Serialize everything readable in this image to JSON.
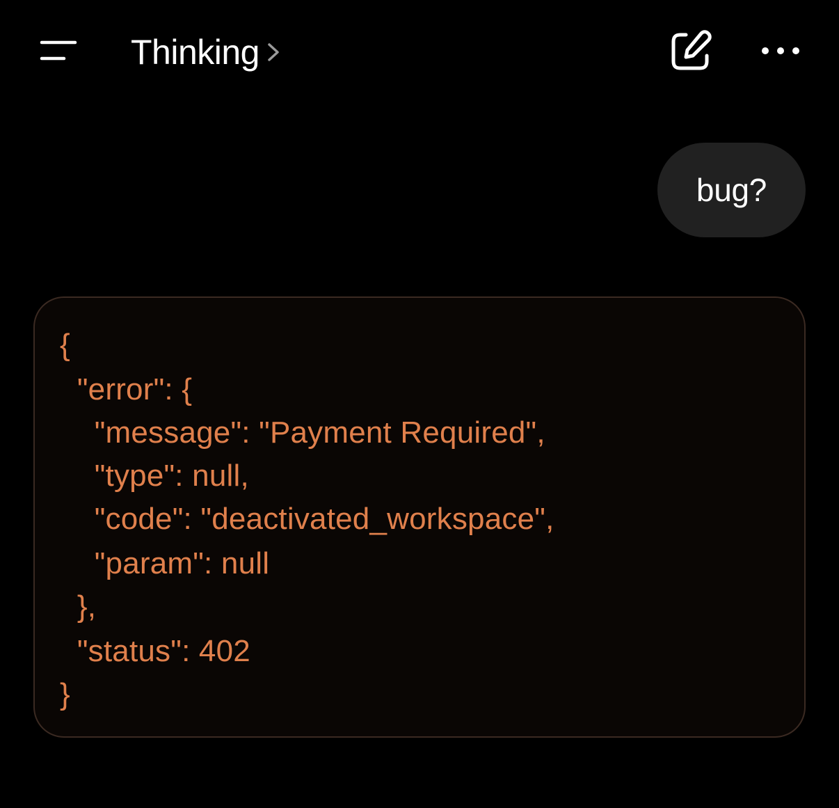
{
  "header": {
    "title": "Thinking",
    "menu_icon": "hamburger-menu-icon",
    "chevron_icon": "chevron-right-icon",
    "compose_icon": "compose-icon",
    "more_icon": "more-dots-icon"
  },
  "conversation": {
    "user_message": "bug?",
    "code_block": {
      "lines": [
        "{",
        "  \"error\": {",
        "    \"message\": \"Payment Required\",",
        "    \"type\": null,",
        "    \"code\": \"deactivated_workspace\",",
        "    \"param\": null",
        "  },",
        "  \"status\": 402",
        "}"
      ]
    }
  },
  "colors": {
    "background": "#000000",
    "text": "#ffffff",
    "user_bubble": "#212121",
    "code_text": "#e0804c",
    "code_background": "#0a0604",
    "code_border": "#3b2a22"
  }
}
